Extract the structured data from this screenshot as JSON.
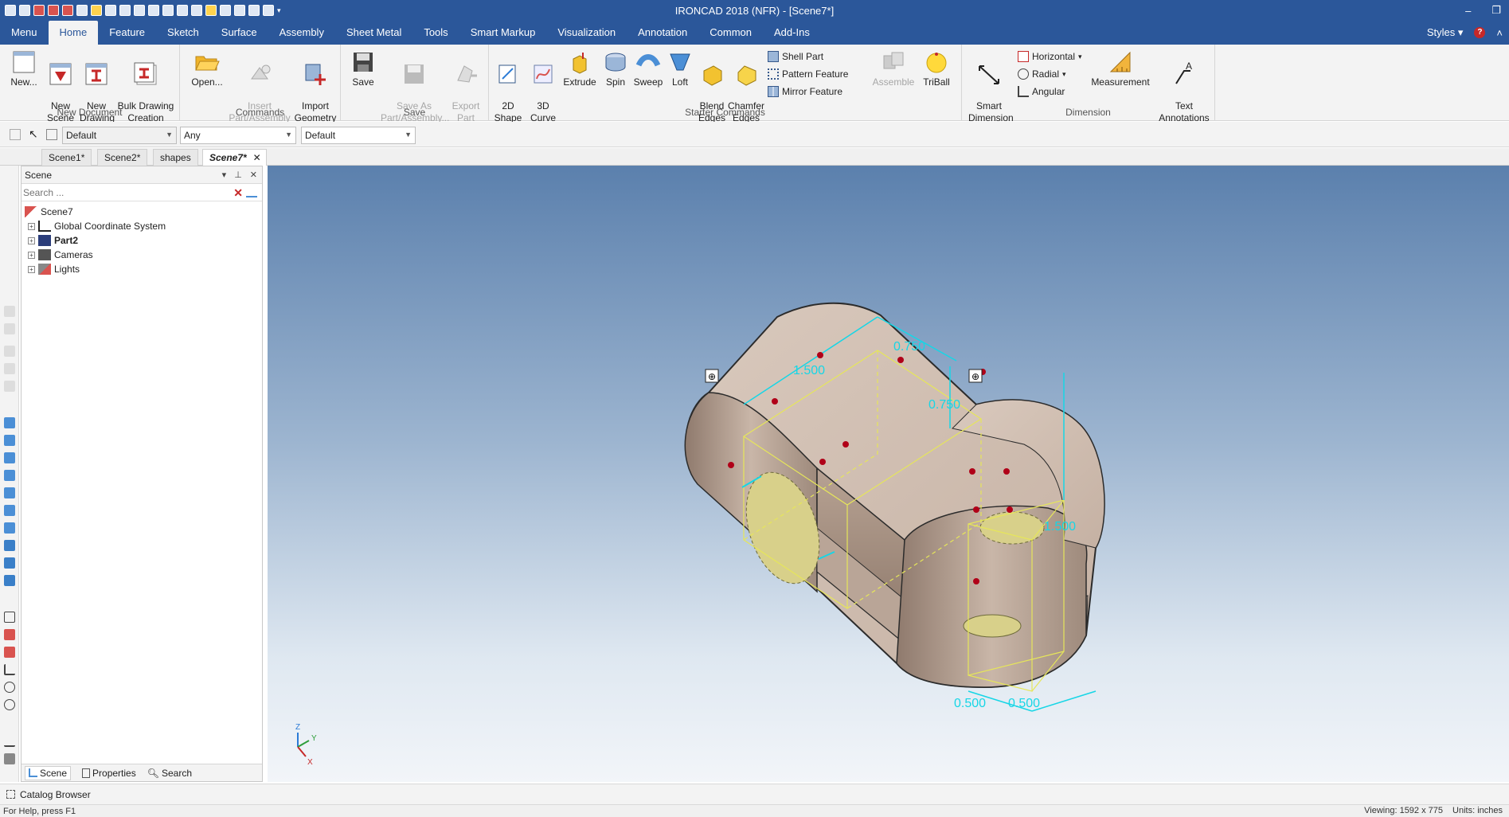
{
  "window": {
    "title": "IRONCAD 2018 (NFR) - [Scene7*]",
    "min_label": "–",
    "restore_label": "❐"
  },
  "ribbon_tabs": [
    "Menu",
    "Home",
    "Feature",
    "Sketch",
    "Surface",
    "Assembly",
    "Sheet Metal",
    "Tools",
    "Smart Markup",
    "Visualization",
    "Annotation",
    "Common",
    "Add-Ins"
  ],
  "active_tab": "Home",
  "tab_right": {
    "styles": "Styles",
    "help": "?"
  },
  "groups": {
    "new_document": {
      "label": "New Document",
      "new": "New...",
      "new_scene": "New\nScene",
      "new_drawing": "New\nDrawing",
      "bulk_drawing": "Bulk Drawing\nCreation"
    },
    "commands": {
      "label": "Commands",
      "open": "Open...",
      "insert": "Insert\nPart/Assembly",
      "import": "Import\nGeometry"
    },
    "save": {
      "label": "Save",
      "save": "Save",
      "save_as": "Save As\nPart/Assembly...",
      "export": "Export\nPart"
    },
    "starter": {
      "label": "Starter Commands",
      "shape2d": "2D\nShape",
      "curve3d": "3D\nCurve",
      "extrude": "Extrude",
      "spin": "Spin",
      "sweep": "Sweep",
      "loft": "Loft",
      "blend": "Blend\nEdges",
      "chamfer": "Chamfer\nEdges",
      "shell": "Shell Part",
      "pattern": "Pattern Feature",
      "mirror": "Mirror Feature",
      "assemble": "Assemble",
      "triball": "TriBall"
    },
    "dimension": {
      "label": "Dimension",
      "smart": "Smart\nDimension",
      "horizontal": "Horizontal",
      "radial": "Radial",
      "angular": "Angular",
      "measurement": "Measurement",
      "text": "Text\nAnnotations"
    }
  },
  "propbar": {
    "style": "Default",
    "filter": "Any",
    "layer": "Default"
  },
  "doc_tabs": [
    "Scene1*",
    "Scene2*",
    "shapes",
    "Scene7*"
  ],
  "active_doc": "Scene7*",
  "browser": {
    "title": "Scene",
    "search_placeholder": "Search ...",
    "root": "Scene7",
    "items": [
      "Global Coordinate System",
      "Part2",
      "Cameras",
      "Lights"
    ],
    "footer": {
      "scene": "Scene",
      "properties": "Properties",
      "search": "Search"
    }
  },
  "viewport": {
    "dims": [
      "1.500",
      "0.750",
      "0.750",
      "1.500",
      "0.500",
      "0.500"
    ],
    "axes": {
      "z": "Z",
      "y": "Y",
      "x": "X"
    }
  },
  "catalog": {
    "label": "Catalog Browser"
  },
  "status": {
    "left": "For Help, press F1",
    "view": "Viewing: 1592 x 775",
    "units": "Units: inches"
  },
  "colors": {
    "title_bar": "#2b579a",
    "ribbon_bg": "#f3f3f3",
    "part": "#c8b5a8",
    "dimension": "#16d6e6",
    "yellow_edges": "#e6e65a"
  }
}
